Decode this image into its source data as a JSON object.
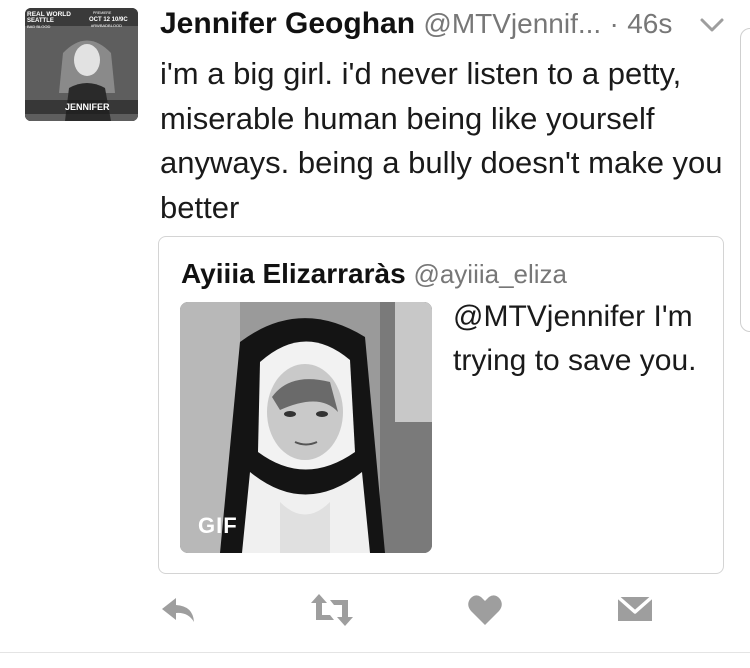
{
  "tweet": {
    "display_name": "Jennifer Geoghan",
    "handle": "@MTVjennif...",
    "separator": "·",
    "time": "46s",
    "text": "i'm a big girl. i'd never listen to a petty, miserable human being like yourself anyways. being a bully doesn't make you better",
    "avatar": {
      "icon": "profile-photo",
      "text_lines": [
        "REAL WORLD",
        "SEATTLE",
        "BAD BLOOD",
        "PREMIERE",
        "OCT 12 10/9C",
        "#RWBADBLOOD",
        "JENNIFER"
      ]
    }
  },
  "quote": {
    "display_name": "Ayiiia Elizarraràs",
    "handle": "@ayiiia_eliza",
    "text": "@MTVjennifer I'm trying to save you.",
    "gif_label": "GIF",
    "media_icon": "nun-gif-thumbnail"
  },
  "actions": {
    "reply_icon": "reply-icon",
    "retweet_icon": "retweet-icon",
    "like_icon": "heart-icon",
    "message_icon": "direct-message-icon"
  },
  "colors": {
    "text": "#1a1a1a",
    "secondary": "#777777",
    "icon": "#9e9e9e",
    "border": "#d4d4d4"
  }
}
